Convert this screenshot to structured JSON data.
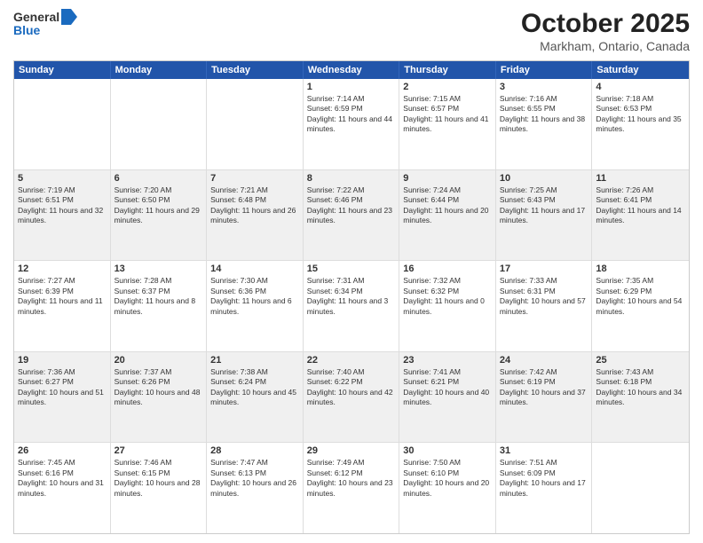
{
  "header": {
    "logo_line1": "General",
    "logo_line2": "Blue",
    "month_title": "October 2025",
    "location": "Markham, Ontario, Canada"
  },
  "days_of_week": [
    "Sunday",
    "Monday",
    "Tuesday",
    "Wednesday",
    "Thursday",
    "Friday",
    "Saturday"
  ],
  "rows": [
    [
      {
        "day": "",
        "text": ""
      },
      {
        "day": "",
        "text": ""
      },
      {
        "day": "",
        "text": ""
      },
      {
        "day": "1",
        "text": "Sunrise: 7:14 AM\nSunset: 6:59 PM\nDaylight: 11 hours and 44 minutes."
      },
      {
        "day": "2",
        "text": "Sunrise: 7:15 AM\nSunset: 6:57 PM\nDaylight: 11 hours and 41 minutes."
      },
      {
        "day": "3",
        "text": "Sunrise: 7:16 AM\nSunset: 6:55 PM\nDaylight: 11 hours and 38 minutes."
      },
      {
        "day": "4",
        "text": "Sunrise: 7:18 AM\nSunset: 6:53 PM\nDaylight: 11 hours and 35 minutes."
      }
    ],
    [
      {
        "day": "5",
        "text": "Sunrise: 7:19 AM\nSunset: 6:51 PM\nDaylight: 11 hours and 32 minutes."
      },
      {
        "day": "6",
        "text": "Sunrise: 7:20 AM\nSunset: 6:50 PM\nDaylight: 11 hours and 29 minutes."
      },
      {
        "day": "7",
        "text": "Sunrise: 7:21 AM\nSunset: 6:48 PM\nDaylight: 11 hours and 26 minutes."
      },
      {
        "day": "8",
        "text": "Sunrise: 7:22 AM\nSunset: 6:46 PM\nDaylight: 11 hours and 23 minutes."
      },
      {
        "day": "9",
        "text": "Sunrise: 7:24 AM\nSunset: 6:44 PM\nDaylight: 11 hours and 20 minutes."
      },
      {
        "day": "10",
        "text": "Sunrise: 7:25 AM\nSunset: 6:43 PM\nDaylight: 11 hours and 17 minutes."
      },
      {
        "day": "11",
        "text": "Sunrise: 7:26 AM\nSunset: 6:41 PM\nDaylight: 11 hours and 14 minutes."
      }
    ],
    [
      {
        "day": "12",
        "text": "Sunrise: 7:27 AM\nSunset: 6:39 PM\nDaylight: 11 hours and 11 minutes."
      },
      {
        "day": "13",
        "text": "Sunrise: 7:28 AM\nSunset: 6:37 PM\nDaylight: 11 hours and 8 minutes."
      },
      {
        "day": "14",
        "text": "Sunrise: 7:30 AM\nSunset: 6:36 PM\nDaylight: 11 hours and 6 minutes."
      },
      {
        "day": "15",
        "text": "Sunrise: 7:31 AM\nSunset: 6:34 PM\nDaylight: 11 hours and 3 minutes."
      },
      {
        "day": "16",
        "text": "Sunrise: 7:32 AM\nSunset: 6:32 PM\nDaylight: 11 hours and 0 minutes."
      },
      {
        "day": "17",
        "text": "Sunrise: 7:33 AM\nSunset: 6:31 PM\nDaylight: 10 hours and 57 minutes."
      },
      {
        "day": "18",
        "text": "Sunrise: 7:35 AM\nSunset: 6:29 PM\nDaylight: 10 hours and 54 minutes."
      }
    ],
    [
      {
        "day": "19",
        "text": "Sunrise: 7:36 AM\nSunset: 6:27 PM\nDaylight: 10 hours and 51 minutes."
      },
      {
        "day": "20",
        "text": "Sunrise: 7:37 AM\nSunset: 6:26 PM\nDaylight: 10 hours and 48 minutes."
      },
      {
        "day": "21",
        "text": "Sunrise: 7:38 AM\nSunset: 6:24 PM\nDaylight: 10 hours and 45 minutes."
      },
      {
        "day": "22",
        "text": "Sunrise: 7:40 AM\nSunset: 6:22 PM\nDaylight: 10 hours and 42 minutes."
      },
      {
        "day": "23",
        "text": "Sunrise: 7:41 AM\nSunset: 6:21 PM\nDaylight: 10 hours and 40 minutes."
      },
      {
        "day": "24",
        "text": "Sunrise: 7:42 AM\nSunset: 6:19 PM\nDaylight: 10 hours and 37 minutes."
      },
      {
        "day": "25",
        "text": "Sunrise: 7:43 AM\nSunset: 6:18 PM\nDaylight: 10 hours and 34 minutes."
      }
    ],
    [
      {
        "day": "26",
        "text": "Sunrise: 7:45 AM\nSunset: 6:16 PM\nDaylight: 10 hours and 31 minutes."
      },
      {
        "day": "27",
        "text": "Sunrise: 7:46 AM\nSunset: 6:15 PM\nDaylight: 10 hours and 28 minutes."
      },
      {
        "day": "28",
        "text": "Sunrise: 7:47 AM\nSunset: 6:13 PM\nDaylight: 10 hours and 26 minutes."
      },
      {
        "day": "29",
        "text": "Sunrise: 7:49 AM\nSunset: 6:12 PM\nDaylight: 10 hours and 23 minutes."
      },
      {
        "day": "30",
        "text": "Sunrise: 7:50 AM\nSunset: 6:10 PM\nDaylight: 10 hours and 20 minutes."
      },
      {
        "day": "31",
        "text": "Sunrise: 7:51 AM\nSunset: 6:09 PM\nDaylight: 10 hours and 17 minutes."
      },
      {
        "day": "",
        "text": ""
      }
    ]
  ]
}
